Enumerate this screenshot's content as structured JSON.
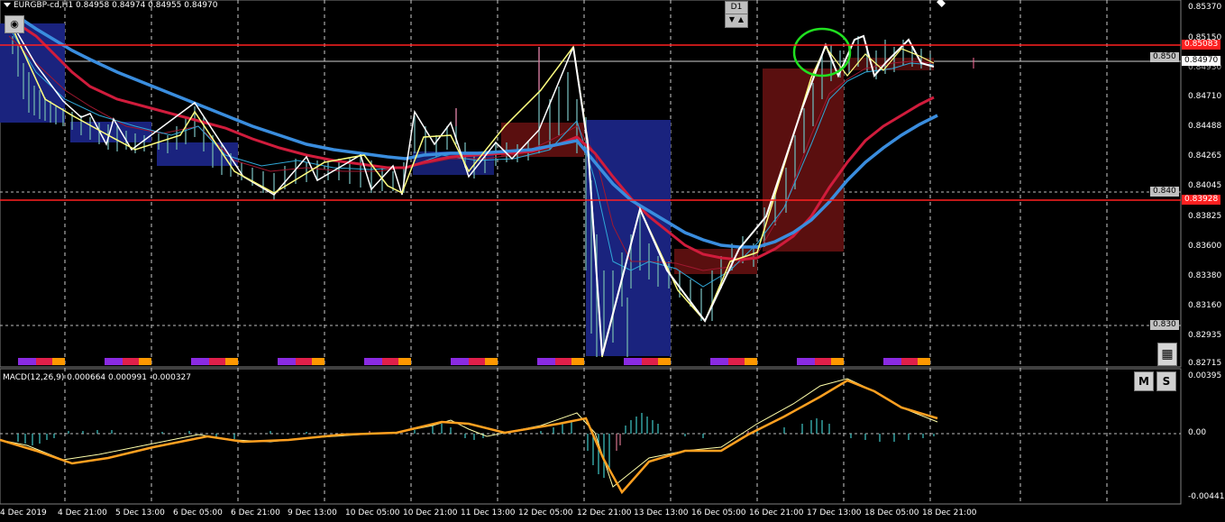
{
  "symbol_header": "EURGBP-cd,H1  0.84958 0.84974 0.84955 0.84970",
  "timeframe": {
    "label": "D1",
    "down": "▼",
    "up": "▲"
  },
  "price_axis": [
    "0.85370",
    "0.85150",
    "0.84930",
    "0.84710",
    "0.84488",
    "0.84265",
    "0.84045",
    "0.83825",
    "0.83600",
    "0.83380",
    "0.83160",
    "0.82935",
    "0.82715"
  ],
  "price_tags": {
    "upper_red": "0.85083",
    "current": "0.84970",
    "round_850": "0.850",
    "round_840": "0.840",
    "lower_red": "0.83928",
    "round_830": "0.830"
  },
  "macd": {
    "label": "MACD(12,26,9) 0.000664 0.000991 -0.000327",
    "axis": [
      "0.00395",
      "0.00",
      "-0.00441"
    ]
  },
  "buttons": {
    "m": "M",
    "s": "S",
    "calculator": "calculator-icon",
    "eye": "eye-icon"
  },
  "time_axis": [
    "4 Dec 2019",
    "4 Dec 21:00",
    "5 Dec 13:00",
    "6 Dec 05:00",
    "6 Dec 21:00",
    "9 Dec 13:00",
    "10 Dec 05:00",
    "10 Dec 21:00",
    "11 Dec 13:00",
    "12 Dec 05:00",
    "12 Dec 21:00",
    "13 Dec 13:00",
    "16 Dec 05:00",
    "16 Dec 21:00",
    "17 Dec 13:00",
    "18 Dec 05:00",
    "18 Dec 21:00"
  ],
  "colors": {
    "background": "#000000",
    "level_red": "#ff2020",
    "ma_blue": "#3a8dde",
    "ma_red": "#d01c3c",
    "zigzag": "#ffffff",
    "zigzag_yellow": "#ffff80",
    "macd_signal": "#ffa020",
    "macd_hist": "#40c8c8",
    "box_blue": "#1a237e",
    "box_red": "#5a0f0f"
  }
}
